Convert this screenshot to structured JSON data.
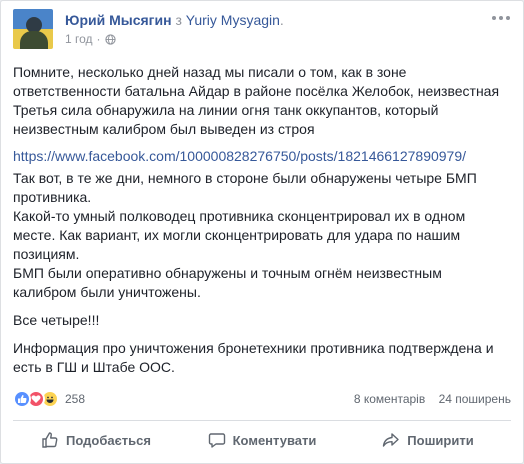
{
  "post": {
    "author": "Юрий Мысягин",
    "via_text": " з ",
    "page_name": "Yuriy Mysyagin",
    "page_suffix": ".",
    "time": "1 год",
    "privacy_icon": "globe-icon",
    "more_icon": "more-options-icon"
  },
  "content": {
    "paragraph1": "Помните, несколько дней назад мы писали о том, как в зоне ответственности батальна Айдар в районе посёлка Желобок, неизвестная Третья сила обнаружила на линии огня танк оккупантов, который неизвестным калибром был выведен из строя",
    "link": "https://www.facebook.com/100000828276750/posts/1821466127890979/",
    "paragraph3_line1": "Так вот, в те же дни, немного в стороне были обнаружены четыре БМП противника.",
    "paragraph3_line2": "Какой-то умный полководец противника сконцентрировал их в одном месте. Как вариант, их могли сконцентрировать для удара по нашим позициям.",
    "paragraph3_line3": "БМП были оперативно обнаружены и точным огнём неизвестным калибром были уничтожены.",
    "paragraph4": "Все четыре!!!",
    "paragraph5": "Информация про уничтожения бронетехники противника подтверждена и есть в ГШ и Штабе ООС."
  },
  "reactions": {
    "types": [
      "like",
      "love",
      "haha"
    ],
    "count": "258",
    "comments": "8 коментарів",
    "shares": "24 поширень",
    "colors": {
      "like": "#5890ff",
      "love": "#f25268",
      "haha": "#fcd353"
    }
  },
  "actions": {
    "like_label": "Подобається",
    "comment_label": "Коментувати",
    "share_label": "Поширити"
  }
}
